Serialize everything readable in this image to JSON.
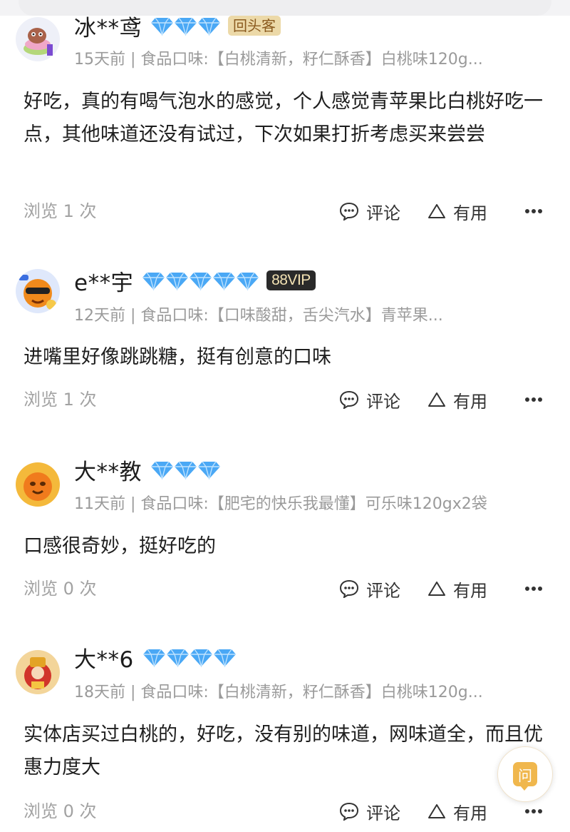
{
  "reviews": [
    {
      "username": "冰**鸢",
      "diamonds": 3,
      "badge": "回头客",
      "badge_type": "returning",
      "meta": "15天前 | 食品口味:【白桃清新，籽仁酥香】白桃味120g...",
      "content": "好吃，真的有喝气泡水的感觉，个人感觉青苹果比白桃好吃一点，其他味道还没有试过，下次如果打折考虑买来尝尝",
      "views": "浏览 1 次",
      "comment_label": "评论",
      "useful_label": "有用",
      "avatar": "cartoon-avatar-stack"
    },
    {
      "username": "e**宇",
      "diamonds": 5,
      "badge": "88VIP",
      "badge_type": "vip",
      "meta": "12天前 | 食品口味:【口味酸甜，舌尖汽水】青苹果...",
      "content": "进嘴里好像跳跳糖，挺有创意的口味",
      "views": "浏览 1 次",
      "comment_label": "评论",
      "useful_label": "有用",
      "avatar": "cartoon-avatar-sunglasses"
    },
    {
      "username": "大**教",
      "diamonds": 3,
      "badge": "",
      "badge_type": "",
      "meta": "11天前 | 食品口味:【肥宅的快乐我最懂】可乐味120gx2袋",
      "content": "口感很奇妙，挺好吃的",
      "views": "浏览 0 次",
      "comment_label": "评论",
      "useful_label": "有用",
      "avatar": "cartoon-avatar-orange"
    },
    {
      "username": "大**6",
      "diamonds": 4,
      "badge": "",
      "badge_type": "",
      "meta": "18天前 | 食品口味:【白桃清新，籽仁酥香】白桃味120g...",
      "content": "实体店买过白桃的，好吃，没有别的味道，网味道全，而且优惠力度大",
      "views": "浏览 0 次",
      "comment_label": "评论",
      "useful_label": "有用",
      "avatar": "cartoon-avatar-caishen"
    }
  ],
  "ask_button": {
    "label": "问"
  },
  "colors": {
    "diamond": "#4aa8f5",
    "meta_text": "#9a9a9a",
    "ask_accent": "#f0b74d"
  }
}
